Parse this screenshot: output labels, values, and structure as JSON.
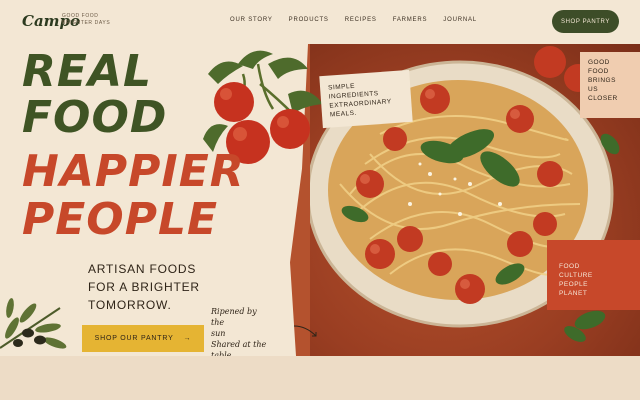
{
  "brand": {
    "logo": "Campo",
    "tagline_line1": "GOOD FOOD",
    "tagline_line2": "BRIGHTER DAYS"
  },
  "nav": {
    "items": [
      "OUR STORY",
      "PRODUCTS",
      "RECIPES",
      "FARMERS",
      "JOURNAL"
    ]
  },
  "header": {
    "shop_label": "SHOP PANTRY"
  },
  "hero": {
    "line1": "REAL",
    "line2": "FOOD",
    "line3": "HAPPIER",
    "line4": "PEOPLE",
    "subtitle_line1": "ARTISAN FOODS",
    "subtitle_line2": "FOR A BRIGHTER",
    "subtitle_line3": "TOMORROW.",
    "cta_label": "SHOP OUR PANTRY",
    "cta_arrow": "→",
    "handwritten_line1": "Ripened by the",
    "handwritten_line2": "sun",
    "handwritten_line3": "Shared at the",
    "handwritten_line4": "table"
  },
  "notes": {
    "ingredients_line1": "SIMPLE",
    "ingredients_line2": "INGREDIENTS",
    "ingredients_line3": "EXTRAORDINARY",
    "ingredients_line4": "MEALS.",
    "closer_line1": "GOOD",
    "closer_line2": "FOOD",
    "closer_line3": "BRINGS",
    "closer_line4": "US",
    "closer_line5": "CLOSER",
    "values_line1": "FOOD",
    "values_line2": "CULTURE",
    "values_line3": "PEOPLE",
    "values_line4": "PLANET"
  },
  "icons": {
    "arrow": "arrow-right-icon",
    "leaf": "leaf-icon",
    "tomato": "tomato-vine-icon",
    "olive": "olive-branch-icon",
    "basil": "basil-icon"
  },
  "colors": {
    "olive_green": "#3f5424",
    "tomato_red": "#c7482a",
    "cream": "#f3e7d4",
    "mustard": "#e5b433",
    "dark_green_button": "#3d4d28"
  }
}
